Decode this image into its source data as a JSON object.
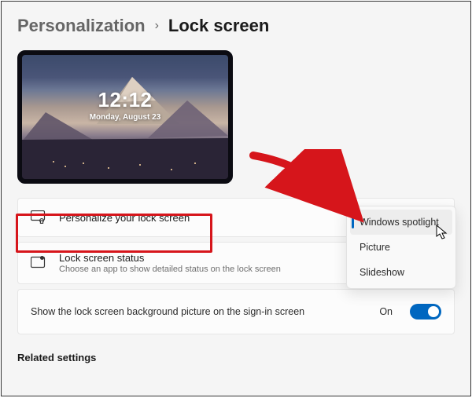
{
  "breadcrumb": {
    "parent": "Personalization",
    "current": "Lock screen"
  },
  "preview": {
    "time": "12:12",
    "date": "Monday, August 23"
  },
  "cards": {
    "personalize": {
      "title": "Personalize your lock screen"
    },
    "status": {
      "title": "Lock screen status",
      "subtitle": "Choose an app to show detailed status on the lock screen"
    }
  },
  "toggle": {
    "label": "Show the lock screen background picture on the sign-in screen",
    "state": "On"
  },
  "dropdown": {
    "items": [
      {
        "label": "Windows spotlight",
        "selected": true
      },
      {
        "label": "Picture",
        "selected": false
      },
      {
        "label": "Slideshow",
        "selected": false
      }
    ]
  },
  "section": {
    "related": "Related settings"
  }
}
